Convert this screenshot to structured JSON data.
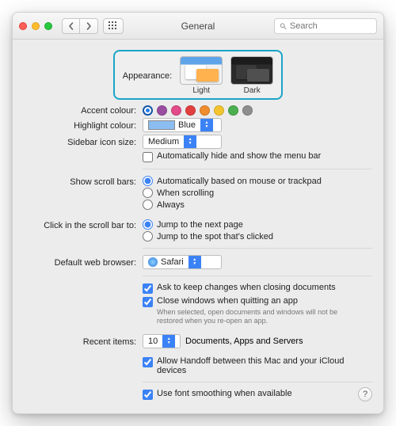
{
  "window": {
    "title": "General"
  },
  "search": {
    "placeholder": "Search"
  },
  "appearance": {
    "label": "Appearance:",
    "light": "Light",
    "dark": "Dark"
  },
  "accent": {
    "label": "Accent colour:",
    "colors": [
      "#1f7df1",
      "#9a4ea0",
      "#e24a8a",
      "#e23f3f",
      "#ef8d2d",
      "#f4c430",
      "#4caf50",
      "#8e8e8e"
    ],
    "selected_index": 0
  },
  "highlight": {
    "label": "Highlight colour:",
    "value": "Blue"
  },
  "sidebar_icon": {
    "label": "Sidebar icon size:",
    "value": "Medium"
  },
  "autohide_menubar": {
    "label": "Automatically hide and show the menu bar",
    "checked": false
  },
  "scroll_bars": {
    "label": "Show scroll bars:",
    "options": [
      "Automatically based on mouse or trackpad",
      "When scrolling",
      "Always"
    ],
    "selected_index": 0
  },
  "click_scroll": {
    "label": "Click in the scroll bar to:",
    "options": [
      "Jump to the next page",
      "Jump to the spot that's clicked"
    ],
    "selected_index": 0
  },
  "default_browser": {
    "label": "Default web browser:",
    "value": "Safari"
  },
  "ask_changes": {
    "label": "Ask to keep changes when closing documents",
    "checked": true
  },
  "close_windows": {
    "label": "Close windows when quitting an app",
    "note": "When selected, open documents and windows will not be restored when you re-open an app.",
    "checked": true
  },
  "recent_items": {
    "label": "Recent items:",
    "value": "10",
    "suffix": "Documents, Apps and Servers"
  },
  "handoff": {
    "label": "Allow Handoff between this Mac and your iCloud devices",
    "checked": true
  },
  "font_smoothing": {
    "label": "Use font smoothing when available",
    "checked": true
  }
}
